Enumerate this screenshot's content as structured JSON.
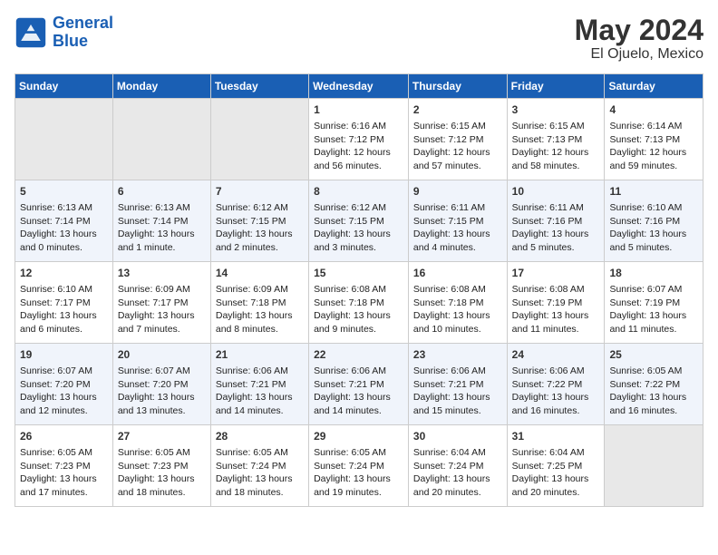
{
  "logo": {
    "line1": "General",
    "line2": "Blue"
  },
  "title": "May 2024",
  "subtitle": "El Ojuelo, Mexico",
  "days_header": [
    "Sunday",
    "Monday",
    "Tuesday",
    "Wednesday",
    "Thursday",
    "Friday",
    "Saturday"
  ],
  "weeks": [
    [
      {
        "num": "",
        "info": ""
      },
      {
        "num": "",
        "info": ""
      },
      {
        "num": "",
        "info": ""
      },
      {
        "num": "1",
        "info": "Sunrise: 6:16 AM\nSunset: 7:12 PM\nDaylight: 12 hours\nand 56 minutes."
      },
      {
        "num": "2",
        "info": "Sunrise: 6:15 AM\nSunset: 7:12 PM\nDaylight: 12 hours\nand 57 minutes."
      },
      {
        "num": "3",
        "info": "Sunrise: 6:15 AM\nSunset: 7:13 PM\nDaylight: 12 hours\nand 58 minutes."
      },
      {
        "num": "4",
        "info": "Sunrise: 6:14 AM\nSunset: 7:13 PM\nDaylight: 12 hours\nand 59 minutes."
      }
    ],
    [
      {
        "num": "5",
        "info": "Sunrise: 6:13 AM\nSunset: 7:14 PM\nDaylight: 13 hours\nand 0 minutes."
      },
      {
        "num": "6",
        "info": "Sunrise: 6:13 AM\nSunset: 7:14 PM\nDaylight: 13 hours\nand 1 minute."
      },
      {
        "num": "7",
        "info": "Sunrise: 6:12 AM\nSunset: 7:15 PM\nDaylight: 13 hours\nand 2 minutes."
      },
      {
        "num": "8",
        "info": "Sunrise: 6:12 AM\nSunset: 7:15 PM\nDaylight: 13 hours\nand 3 minutes."
      },
      {
        "num": "9",
        "info": "Sunrise: 6:11 AM\nSunset: 7:15 PM\nDaylight: 13 hours\nand 4 minutes."
      },
      {
        "num": "10",
        "info": "Sunrise: 6:11 AM\nSunset: 7:16 PM\nDaylight: 13 hours\nand 5 minutes."
      },
      {
        "num": "11",
        "info": "Sunrise: 6:10 AM\nSunset: 7:16 PM\nDaylight: 13 hours\nand 5 minutes."
      }
    ],
    [
      {
        "num": "12",
        "info": "Sunrise: 6:10 AM\nSunset: 7:17 PM\nDaylight: 13 hours\nand 6 minutes."
      },
      {
        "num": "13",
        "info": "Sunrise: 6:09 AM\nSunset: 7:17 PM\nDaylight: 13 hours\nand 7 minutes."
      },
      {
        "num": "14",
        "info": "Sunrise: 6:09 AM\nSunset: 7:18 PM\nDaylight: 13 hours\nand 8 minutes."
      },
      {
        "num": "15",
        "info": "Sunrise: 6:08 AM\nSunset: 7:18 PM\nDaylight: 13 hours\nand 9 minutes."
      },
      {
        "num": "16",
        "info": "Sunrise: 6:08 AM\nSunset: 7:18 PM\nDaylight: 13 hours\nand 10 minutes."
      },
      {
        "num": "17",
        "info": "Sunrise: 6:08 AM\nSunset: 7:19 PM\nDaylight: 13 hours\nand 11 minutes."
      },
      {
        "num": "18",
        "info": "Sunrise: 6:07 AM\nSunset: 7:19 PM\nDaylight: 13 hours\nand 11 minutes."
      }
    ],
    [
      {
        "num": "19",
        "info": "Sunrise: 6:07 AM\nSunset: 7:20 PM\nDaylight: 13 hours\nand 12 minutes."
      },
      {
        "num": "20",
        "info": "Sunrise: 6:07 AM\nSunset: 7:20 PM\nDaylight: 13 hours\nand 13 minutes."
      },
      {
        "num": "21",
        "info": "Sunrise: 6:06 AM\nSunset: 7:21 PM\nDaylight: 13 hours\nand 14 minutes."
      },
      {
        "num": "22",
        "info": "Sunrise: 6:06 AM\nSunset: 7:21 PM\nDaylight: 13 hours\nand 14 minutes."
      },
      {
        "num": "23",
        "info": "Sunrise: 6:06 AM\nSunset: 7:21 PM\nDaylight: 13 hours\nand 15 minutes."
      },
      {
        "num": "24",
        "info": "Sunrise: 6:06 AM\nSunset: 7:22 PM\nDaylight: 13 hours\nand 16 minutes."
      },
      {
        "num": "25",
        "info": "Sunrise: 6:05 AM\nSunset: 7:22 PM\nDaylight: 13 hours\nand 16 minutes."
      }
    ],
    [
      {
        "num": "26",
        "info": "Sunrise: 6:05 AM\nSunset: 7:23 PM\nDaylight: 13 hours\nand 17 minutes."
      },
      {
        "num": "27",
        "info": "Sunrise: 6:05 AM\nSunset: 7:23 PM\nDaylight: 13 hours\nand 18 minutes."
      },
      {
        "num": "28",
        "info": "Sunrise: 6:05 AM\nSunset: 7:24 PM\nDaylight: 13 hours\nand 18 minutes."
      },
      {
        "num": "29",
        "info": "Sunrise: 6:05 AM\nSunset: 7:24 PM\nDaylight: 13 hours\nand 19 minutes."
      },
      {
        "num": "30",
        "info": "Sunrise: 6:04 AM\nSunset: 7:24 PM\nDaylight: 13 hours\nand 20 minutes."
      },
      {
        "num": "31",
        "info": "Sunrise: 6:04 AM\nSunset: 7:25 PM\nDaylight: 13 hours\nand 20 minutes."
      },
      {
        "num": "",
        "info": ""
      }
    ]
  ]
}
